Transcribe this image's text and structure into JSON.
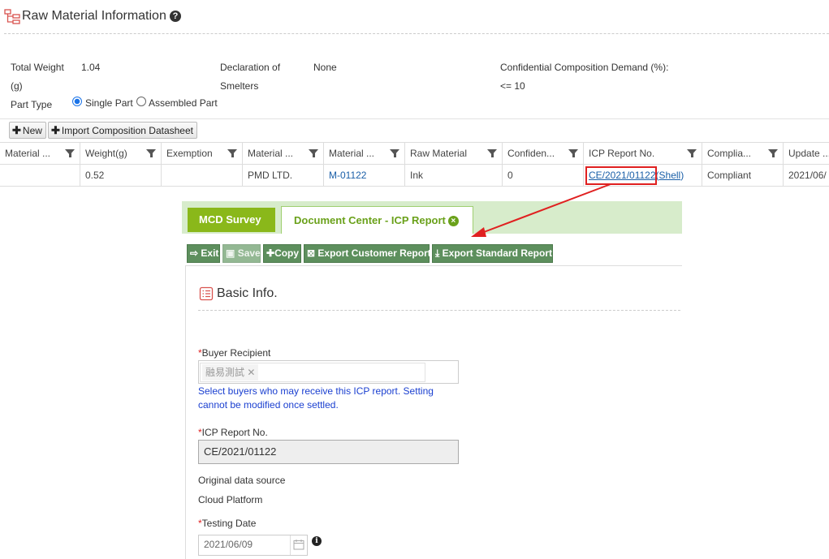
{
  "header": {
    "title": "Raw Material Information",
    "help_symbol": "?"
  },
  "info": {
    "total_weight_label_1": "Total Weight",
    "total_weight_label_2": "(g)",
    "total_weight_value": "1.04",
    "declaration_label_1": "Declaration of",
    "declaration_label_2": "Smelters",
    "declaration_value": "None",
    "confidential_label": "Confidential Composition Demand (%):",
    "confidential_value": "<= 10",
    "part_type_label": "Part Type",
    "part_type_options": [
      "Single Part",
      "Assembled Part"
    ],
    "part_type_selected": "Single Part"
  },
  "toolbar": {
    "new_label": "New",
    "import_label": "Import Composition Datasheet"
  },
  "table": {
    "columns": [
      "Material ...",
      "Weight(g)",
      "Exemption",
      "Material ...",
      "Material ...",
      "Raw Material",
      "Confiden...",
      "ICP Report No.",
      "Complia...",
      "Update ..."
    ],
    "row": {
      "material": "",
      "weight": "0.52",
      "exemption": "",
      "supplier": "PMD LTD.",
      "material_no": "M-01122",
      "raw_material": "Ink",
      "confidential": "0",
      "icp_report_no": "CE/2021/01122",
      "icp_suffix_open": "(",
      "icp_shell": "Shell",
      "icp_suffix_close": ")",
      "compliance": "Compliant",
      "update": "2021/06/"
    }
  },
  "panel": {
    "tabs": {
      "mcd": "MCD Survey",
      "doc": "Document Center - ICP Report",
      "close_symbol": "×"
    },
    "buttons": {
      "exit": "Exit",
      "save": "Save",
      "copy": "Copy",
      "export_customer": "Export Customer Report",
      "export_standard": "Export Standard Report"
    },
    "basic_info_title": "Basic Info.",
    "buyer_label": "Buyer Recipient",
    "buyer_tag": "融易測試",
    "buyer_tag_remove": "✕",
    "buyer_hint_1": "Select buyers who may receive this ICP report. Setting",
    "buyer_hint_2": "cannot be modified once settled.",
    "icp_label": "ICP Report No.",
    "icp_value": "CE/2021/01122",
    "source_label": "Original data source",
    "source_value": "Cloud Platform",
    "testing_label": "Testing Date",
    "testing_value": "2021/06/09",
    "required_mark": "*",
    "info_symbol": "i"
  },
  "colors": {
    "accent_green": "#8ab81a",
    "button_green": "#5d8f5d",
    "annotation_red": "#e02020",
    "link_blue": "#1a5fa8",
    "hint_blue": "#1a3fd0"
  }
}
